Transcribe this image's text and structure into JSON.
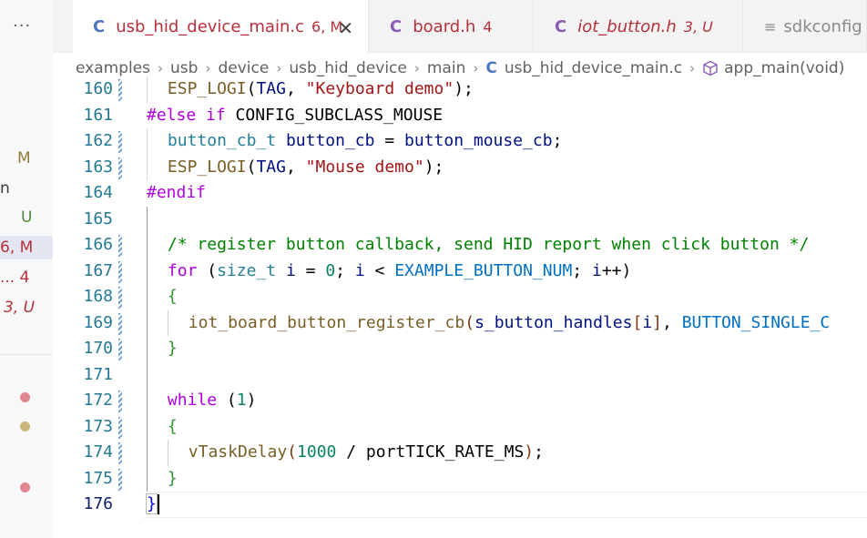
{
  "explorer": {
    "more_label": "···",
    "rows": [
      {
        "text": "M",
        "color": "#8f7a3f"
      },
      {
        "text": "n",
        "color": "#3a3a3a"
      },
      {
        "text": "U",
        "color": "#4d8a3c"
      },
      {
        "text": "6, M",
        "color": "#b5303a"
      },
      {
        "text": "... 4",
        "color": "#b5303a"
      },
      {
        "text": "3, U",
        "color": "#b5303a"
      }
    ],
    "dot_colors": [
      "#e0868f",
      "#c9b67a",
      "#e0868f"
    ]
  },
  "tabs": [
    {
      "lang": "C",
      "name": "usb_hid_device_main.c",
      "badge": "6, M",
      "active": true,
      "lang_color": "#4e76c0",
      "name_color": "#b5303a",
      "badge_color": "#b5303a"
    },
    {
      "lang": "C",
      "name": "board.h",
      "badge": "4",
      "active": false,
      "lang_color": "#8a5db5",
      "name_color": "#b5303a",
      "badge_color": "#b5303a"
    },
    {
      "lang": "C",
      "name": "iot_button.h",
      "badge": "3, U",
      "active": false,
      "lang_color": "#8a5db5",
      "name_color": "#b5303a",
      "badge_color": "#b5303a"
    },
    {
      "lang": "≡",
      "name": "sdkconfig",
      "badge": "",
      "active": false,
      "lang_color": "#8a8a8a",
      "name_color": "#8a8a8a",
      "badge_color": "#8a8a8a"
    }
  ],
  "breadcrumbs": {
    "items": [
      "examples",
      "usb",
      "device",
      "usb_hid_device",
      "main"
    ],
    "file_lang": "C",
    "file": "usb_hid_device_main.c",
    "symbol": "app_main(void)"
  },
  "editor": {
    "current_line": "176",
    "lines": [
      {
        "num": "160",
        "mod": true,
        "indent": 1,
        "tokens": [
          [
            "ESP_LOGI",
            "fn"
          ],
          [
            "(",
            "plain"
          ],
          [
            "TAG",
            "var"
          ],
          [
            ", ",
            "plain"
          ],
          [
            "\"Keyboard demo\"",
            "str"
          ],
          [
            ");",
            "plain"
          ]
        ]
      },
      {
        "num": "161",
        "mod": false,
        "indent": 0,
        "tokens": [
          [
            "#else if",
            "pp"
          ],
          [
            " CONFIG_SUBCLASS_MOUSE",
            "plain"
          ]
        ]
      },
      {
        "num": "162",
        "mod": true,
        "indent": 1,
        "tokens": [
          [
            "button_cb_t",
            "type"
          ],
          [
            " ",
            "plain"
          ],
          [
            "button_cb",
            "var"
          ],
          [
            " = ",
            "plain"
          ],
          [
            "button_mouse_cb",
            "var"
          ],
          [
            ";",
            "plain"
          ]
        ]
      },
      {
        "num": "163",
        "mod": true,
        "indent": 1,
        "tokens": [
          [
            "ESP_LOGI",
            "fn"
          ],
          [
            "(",
            "plain"
          ],
          [
            "TAG",
            "var"
          ],
          [
            ", ",
            "plain"
          ],
          [
            "\"Mouse demo\"",
            "str"
          ],
          [
            ");",
            "plain"
          ]
        ]
      },
      {
        "num": "164",
        "mod": false,
        "indent": 0,
        "tokens": [
          [
            "#endif",
            "pp"
          ]
        ]
      },
      {
        "num": "165",
        "mod": false,
        "indent": 0,
        "tokens": []
      },
      {
        "num": "166",
        "mod": true,
        "indent": 1,
        "tokens": [
          [
            "/* register button callback, send HID report when click button */",
            "cmt"
          ]
        ]
      },
      {
        "num": "167",
        "mod": true,
        "indent": 1,
        "tokens": [
          [
            "for",
            "pp"
          ],
          [
            " (",
            "plain"
          ],
          [
            "size_t",
            "type"
          ],
          [
            " ",
            "plain"
          ],
          [
            "i",
            "var"
          ],
          [
            " = ",
            "plain"
          ],
          [
            "0",
            "num"
          ],
          [
            "; ",
            "plain"
          ],
          [
            "i",
            "var"
          ],
          [
            " < ",
            "plain"
          ],
          [
            "EXAMPLE_BUTTON_NUM",
            "macro"
          ],
          [
            "; ",
            "plain"
          ],
          [
            "i",
            "var"
          ],
          [
            "++)",
            "plain"
          ]
        ]
      },
      {
        "num": "168",
        "mod": true,
        "indent": 1,
        "tokens": [
          [
            "{",
            "br1"
          ]
        ]
      },
      {
        "num": "169",
        "mod": true,
        "indent": 2,
        "tokens": [
          [
            "iot_board_button_register_cb",
            "fn"
          ],
          [
            "(",
            "br2"
          ],
          [
            "s_button_handles",
            "var"
          ],
          [
            "[",
            "br2"
          ],
          [
            "i",
            "var"
          ],
          [
            "]",
            "br2"
          ],
          [
            ", ",
            "plain"
          ],
          [
            "BUTTON_SINGLE_C",
            "macro"
          ]
        ]
      },
      {
        "num": "170",
        "mod": true,
        "indent": 1,
        "tokens": [
          [
            "}",
            "br1"
          ]
        ]
      },
      {
        "num": "171",
        "mod": false,
        "indent": 0,
        "tokens": []
      },
      {
        "num": "172",
        "mod": true,
        "indent": 1,
        "tokens": [
          [
            "while",
            "pp"
          ],
          [
            " (",
            "plain"
          ],
          [
            "1",
            "num"
          ],
          [
            ")",
            "plain"
          ]
        ]
      },
      {
        "num": "173",
        "mod": true,
        "indent": 1,
        "tokens": [
          [
            "{",
            "br1"
          ]
        ]
      },
      {
        "num": "174",
        "mod": true,
        "indent": 2,
        "tokens": [
          [
            "vTaskDelay",
            "fn"
          ],
          [
            "(",
            "br2"
          ],
          [
            "1000",
            "num"
          ],
          [
            " / ",
            "plain"
          ],
          [
            "portTICK_RATE_MS",
            "plain"
          ],
          [
            ")",
            "br2"
          ],
          [
            ";",
            "plain"
          ]
        ]
      },
      {
        "num": "175",
        "mod": true,
        "indent": 1,
        "tokens": [
          [
            "}",
            "br1"
          ]
        ]
      },
      {
        "num": "176",
        "mod": false,
        "indent": 0,
        "tokens": [
          [
            "}",
            "kw"
          ]
        ]
      }
    ]
  }
}
